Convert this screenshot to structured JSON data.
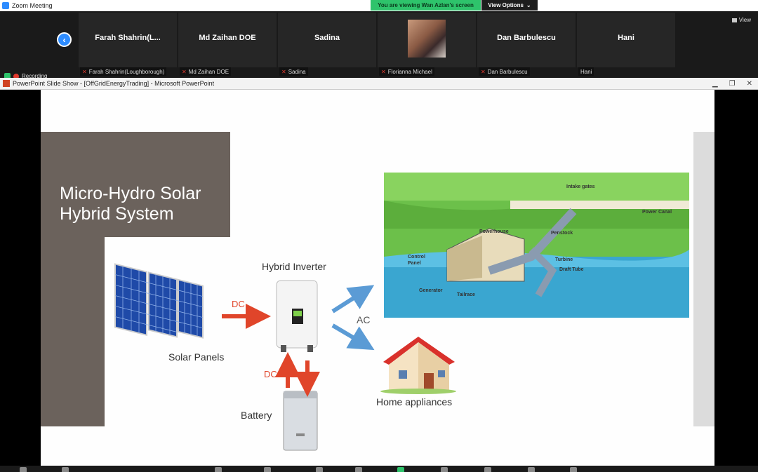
{
  "window": {
    "title": "Zoom Meeting"
  },
  "share": {
    "banner": "You are viewing Wan Azlan's screen",
    "view_options": "View Options"
  },
  "gallery": {
    "view_label": "View",
    "participants": [
      {
        "name": "Farah  Shahrin(L...",
        "label": "Farah Shahrin(Loughborough)",
        "muted": true
      },
      {
        "name": "Md Zaihan DOE",
        "label": "Md Zaihan DOE",
        "muted": true
      },
      {
        "name": "Sadina",
        "label": "Sadina",
        "muted": true
      },
      {
        "name": "",
        "label": "Florianna Michael",
        "muted": true,
        "has_photo": true
      },
      {
        "name": "Dan Barbulescu",
        "label": "Dan Barbulescu",
        "muted": true
      },
      {
        "name": "Hani",
        "label": "Hani",
        "muted": false
      }
    ]
  },
  "recording": {
    "label": "Recording"
  },
  "powerpoint": {
    "title": "PowerPoint Slide Show - [OffGridEnergyTrading] - Microsoft PowerPoint"
  },
  "slide": {
    "title_line1": "Micro-Hydro Solar",
    "title_line2": "Hybrid System",
    "solar_label": "Solar Panels",
    "inverter_label": "Hybrid Inverter",
    "battery_label": "Battery",
    "home_label": "Home appliances",
    "dc_label_1": "DC",
    "dc_label_2": "DC",
    "ac_label": "AC",
    "hydro_labels": {
      "intake": "Intake gates",
      "canal": "Power Canal",
      "powerhouse": "Powerhouse",
      "penstock": "Penstock",
      "control": "Control",
      "control2": "Panel",
      "turbine": "Turbine",
      "draft": "Draft Tube",
      "generator": "Generator",
      "tailrace": "Tailrace"
    }
  },
  "colors": {
    "accent_blue": "#2d8cff",
    "share_green": "#2ec36b",
    "title_box": "#6b625c",
    "dc_red": "#e0452a",
    "ac_blue": "#5b9bd5"
  }
}
